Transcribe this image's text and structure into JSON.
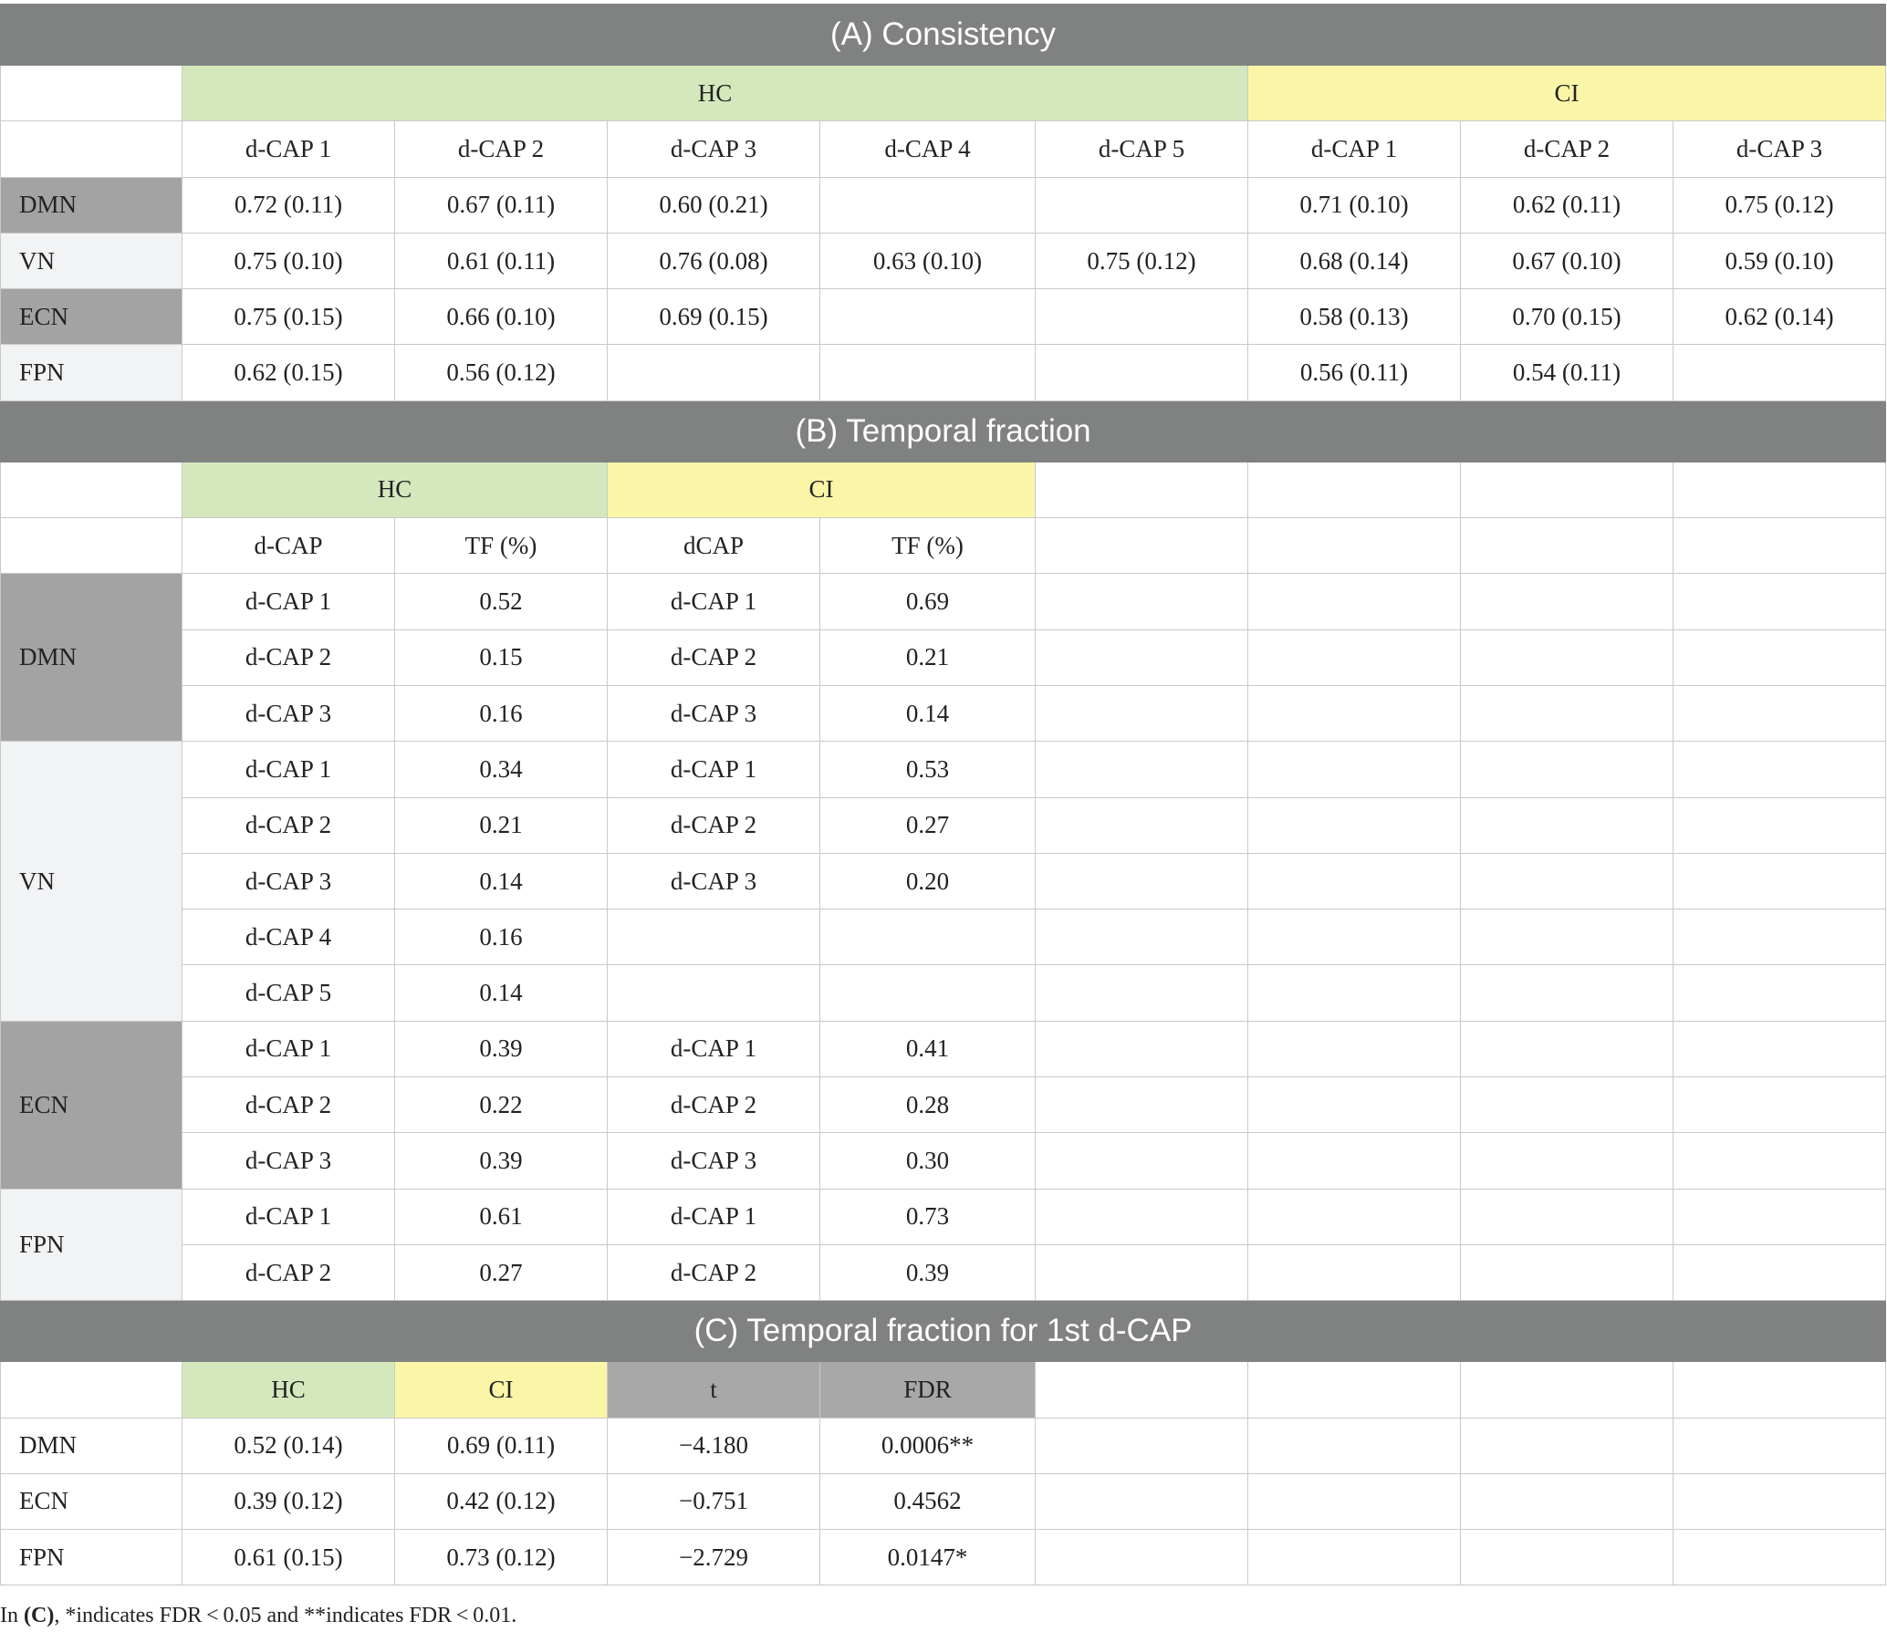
{
  "section_a": {
    "title": "(A) Consistency",
    "group_hc": "HC",
    "group_ci": "CI",
    "col_headers": [
      "d-CAP 1",
      "d-CAP 2",
      "d-CAP 3",
      "d-CAP 4",
      "d-CAP 5",
      "d-CAP 1",
      "d-CAP 2",
      "d-CAP 3"
    ],
    "rows": [
      {
        "label": "DMN",
        "cells": [
          "0.72 (0.11)",
          "0.67 (0.11)",
          "0.60 (0.21)",
          "",
          "",
          "0.71 (0.10)",
          "0.62 (0.11)",
          "0.75 (0.12)"
        ]
      },
      {
        "label": "VN",
        "cells": [
          "0.75 (0.10)",
          "0.61 (0.11)",
          "0.76 (0.08)",
          "0.63 (0.10)",
          "0.75 (0.12)",
          "0.68 (0.14)",
          "0.67 (0.10)",
          "0.59 (0.10)"
        ]
      },
      {
        "label": "ECN",
        "cells": [
          "0.75 (0.15)",
          "0.66 (0.10)",
          "0.69 (0.15)",
          "",
          "",
          "0.58 (0.13)",
          "0.70 (0.15)",
          "0.62 (0.14)"
        ]
      },
      {
        "label": "FPN",
        "cells": [
          "0.62 (0.15)",
          "0.56 (0.12)",
          "",
          "",
          "",
          "0.56 (0.11)",
          "0.54 (0.11)",
          ""
        ]
      }
    ]
  },
  "section_b": {
    "title": "(B) Temporal fraction",
    "group_hc": "HC",
    "group_ci": "CI",
    "col_headers": [
      "d-CAP",
      "TF (%)",
      "dCAP",
      "TF (%)"
    ],
    "groups": [
      {
        "label": "DMN",
        "rows": [
          [
            "d-CAP 1",
            "0.52",
            "d-CAP 1",
            "0.69"
          ],
          [
            "d-CAP 2",
            "0.15",
            "d-CAP 2",
            "0.21"
          ],
          [
            "d-CAP 3",
            "0.16",
            "d-CAP 3",
            "0.14"
          ]
        ]
      },
      {
        "label": "VN",
        "rows": [
          [
            "d-CAP 1",
            "0.34",
            "d-CAP 1",
            "0.53"
          ],
          [
            "d-CAP 2",
            "0.21",
            "d-CAP 2",
            "0.27"
          ],
          [
            "d-CAP 3",
            "0.14",
            "d-CAP 3",
            "0.20"
          ],
          [
            "d-CAP 4",
            "0.16",
            "",
            ""
          ],
          [
            "d-CAP 5",
            "0.14",
            "",
            ""
          ]
        ]
      },
      {
        "label": "ECN",
        "rows": [
          [
            "d-CAP 1",
            "0.39",
            "d-CAP 1",
            "0.41"
          ],
          [
            "d-CAP 2",
            "0.22",
            "d-CAP 2",
            "0.28"
          ],
          [
            "d-CAP 3",
            "0.39",
            "d-CAP 3",
            "0.30"
          ]
        ]
      },
      {
        "label": "FPN",
        "rows": [
          [
            "d-CAP 1",
            "0.61",
            "d-CAP 1",
            "0.73"
          ],
          [
            "d-CAP 2",
            "0.27",
            "d-CAP 2",
            "0.39"
          ]
        ]
      }
    ]
  },
  "section_c": {
    "title": "(C) Temporal fraction for 1st d-CAP",
    "col_headers": [
      "HC",
      "CI",
      "t",
      "FDR"
    ],
    "rows": [
      {
        "label": "DMN",
        "cells": [
          "0.52 (0.14)",
          "0.69 (0.11)",
          "−4.180",
          "0.0006**"
        ]
      },
      {
        "label": "ECN",
        "cells": [
          "0.39 (0.12)",
          "0.42 (0.12)",
          "−0.751",
          "0.4562"
        ]
      },
      {
        "label": "FPN",
        "cells": [
          "0.61 (0.15)",
          "0.73 (0.12)",
          "−2.729",
          "0.0147*"
        ]
      }
    ]
  },
  "footnote": {
    "prefix": "In ",
    "bold": "(C)",
    "text": ", *indicates FDR < 0.05 and **indicates FDR < 0.01."
  },
  "colors": {
    "section_header_bg": "#808281",
    "hc_bg": "#d5e8bd",
    "ci_bg": "#fbf5a8",
    "dark_row_label_bg": "#a3a3a3",
    "light_row_label_bg": "#f2f3f5",
    "stat_header_bg": "#a8a8a8"
  }
}
